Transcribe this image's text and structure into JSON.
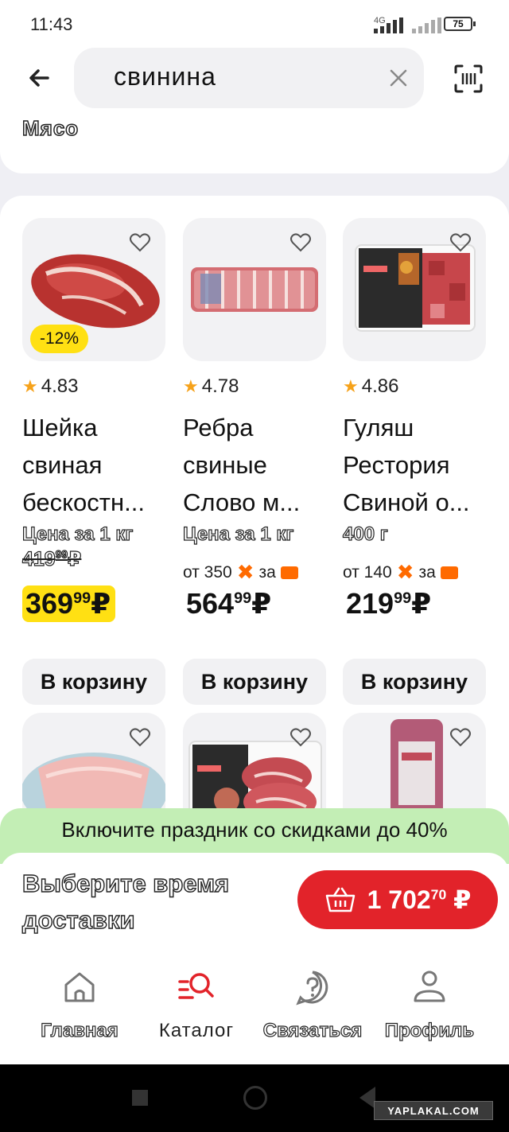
{
  "status": {
    "time": "11:43",
    "network": "4G",
    "battery": "75"
  },
  "search": {
    "query": "свинина"
  },
  "category": {
    "label": "Мясо"
  },
  "products": [
    {
      "rating": "4.83",
      "title_lines": [
        "Шейка",
        "свиная",
        "бескостн..."
      ],
      "unit": "Цена за 1 кг",
      "discount": "-12%",
      "old_price_int": "419",
      "old_price_cents": "99",
      "old_price_cur": "₽",
      "price_int": "369",
      "price_cents": "99",
      "price_cur": "₽",
      "button": "В корзину"
    },
    {
      "rating": "4.78",
      "title_lines": [
        "Ребра",
        "свиные",
        "Слово м..."
      ],
      "unit": "Цена за 1 кг",
      "promo_from": "от 350",
      "promo_for": "за",
      "price_int": "564",
      "price_cents": "99",
      "price_cur": "₽",
      "button": "В корзину"
    },
    {
      "rating": "4.86",
      "title_lines": [
        "Гуляш",
        "Рестория",
        "Свиной о..."
      ],
      "unit": "400 г",
      "promo_from": "от 140",
      "promo_for": "за",
      "price_int": "219",
      "price_cents": "99",
      "price_cur": "₽",
      "button": "В корзину"
    }
  ],
  "banner": {
    "text": "Включите праздник со скидками до 40%"
  },
  "delivery": {
    "line1": "Выберите время",
    "line2": "доставки"
  },
  "cart": {
    "total_int": "1 702",
    "total_cents": "70",
    "currency": "₽"
  },
  "tabs": [
    {
      "label": "Главная",
      "icon": "home-icon"
    },
    {
      "label": "Каталог",
      "icon": "catalog-search-icon"
    },
    {
      "label": "Связаться",
      "icon": "help-icon"
    },
    {
      "label": "Профиль",
      "icon": "profile-icon"
    }
  ],
  "watermark": "YAPLAKAL.COM",
  "colors": {
    "accent_red": "#e2232a",
    "highlight_yellow": "#ffe013",
    "banner_green": "#c3eeb5",
    "promo_orange": "#ff6a00",
    "star": "#f6a21a"
  }
}
